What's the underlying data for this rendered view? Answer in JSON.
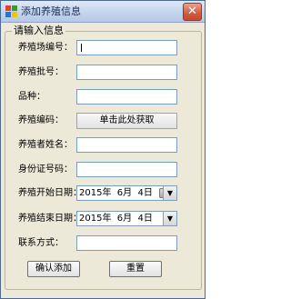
{
  "window": {
    "title": "添加养殖信息",
    "close_glyph": "✕"
  },
  "group": {
    "title": "请输入信息"
  },
  "fields": {
    "farm_id_label": "养殖场编号：",
    "batch_label": "养殖批号：",
    "breed_label": "品种：",
    "code_label": "养殖编码：",
    "code_button": "单击此处获取",
    "farmer_name_label": "养殖者姓名：",
    "id_card_label": "身份证号码：",
    "start_date_label": "养殖开始日期：",
    "start_date_value": "2015年  6月  4日",
    "end_date_label": "养殖结束日期：",
    "end_date_value": "2015年  6月  4日",
    "contact_label": "联系方式："
  },
  "buttons": {
    "confirm": "确认添加",
    "reset": "重置"
  },
  "icons": {
    "app": "app-window-icon",
    "calendar": "calendar-icon",
    "dropdown": "chevron-down-icon"
  },
  "colors": {
    "titlebar": "#c5d6ee",
    "close": "#d05a3f",
    "background": "#ece9d8"
  }
}
